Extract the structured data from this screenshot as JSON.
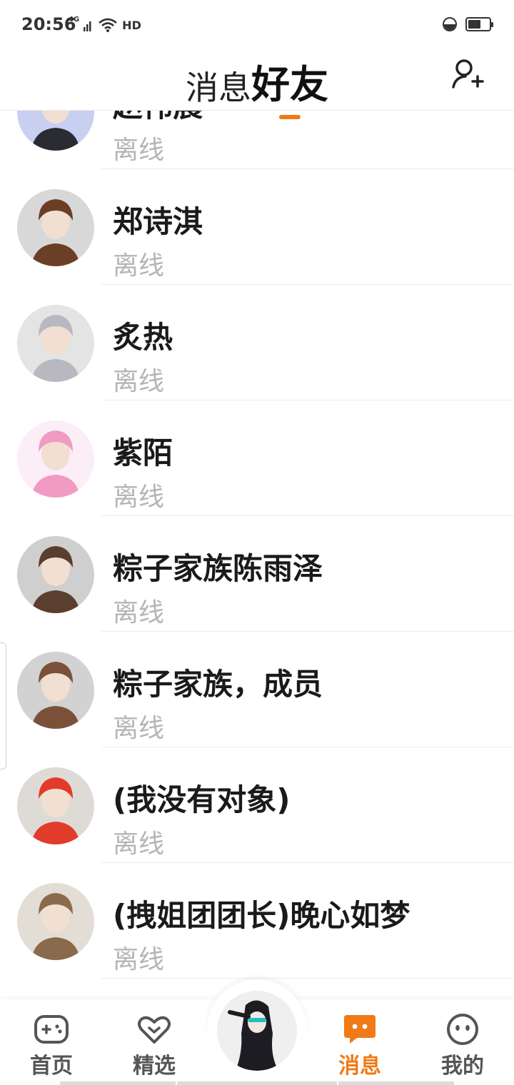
{
  "status_bar": {
    "time": "20:56",
    "network": "4G",
    "hd": "HD",
    "battery_level": 0.6
  },
  "header": {
    "tab_messages": "消息",
    "tab_friends": "好友",
    "active_tab": "好友",
    "accent": "#f07a16"
  },
  "friends": [
    {
      "name": "赵伟晨",
      "status": "离线",
      "avatar_bg": "#c9cff0",
      "avatar_fg": "#2b2b33"
    },
    {
      "name": "郑诗淇",
      "status": "离线",
      "avatar_bg": "#d8d8d8",
      "avatar_fg": "#6b3f25"
    },
    {
      "name": "炙热",
      "status": "离线",
      "avatar_bg": "#e4e4e4",
      "avatar_fg": "#b8b8c0"
    },
    {
      "name": "紫陌",
      "status": "离线",
      "avatar_bg": "#fbeef6",
      "avatar_fg": "#f19ac4"
    },
    {
      "name": "粽子家族陈雨泽",
      "status": "离线",
      "avatar_bg": "#cfcfcf",
      "avatar_fg": "#5a3e2e"
    },
    {
      "name": "粽子家族，成员",
      "status": "离线",
      "avatar_bg": "#d2d2d2",
      "avatar_fg": "#7a5138"
    },
    {
      "name": "(我没有对象)",
      "status": "离线",
      "avatar_bg": "#dedbd6",
      "avatar_fg": "#e23b2b"
    },
    {
      "name": "(拽姐团团长)晚心如梦",
      "status": "离线",
      "avatar_bg": "#e2ddd5",
      "avatar_fg": "#8a6a4c"
    }
  ],
  "bottom_nav": {
    "home": "首页",
    "featured": "精选",
    "messages": "消息",
    "me": "我的",
    "active": "消息"
  }
}
